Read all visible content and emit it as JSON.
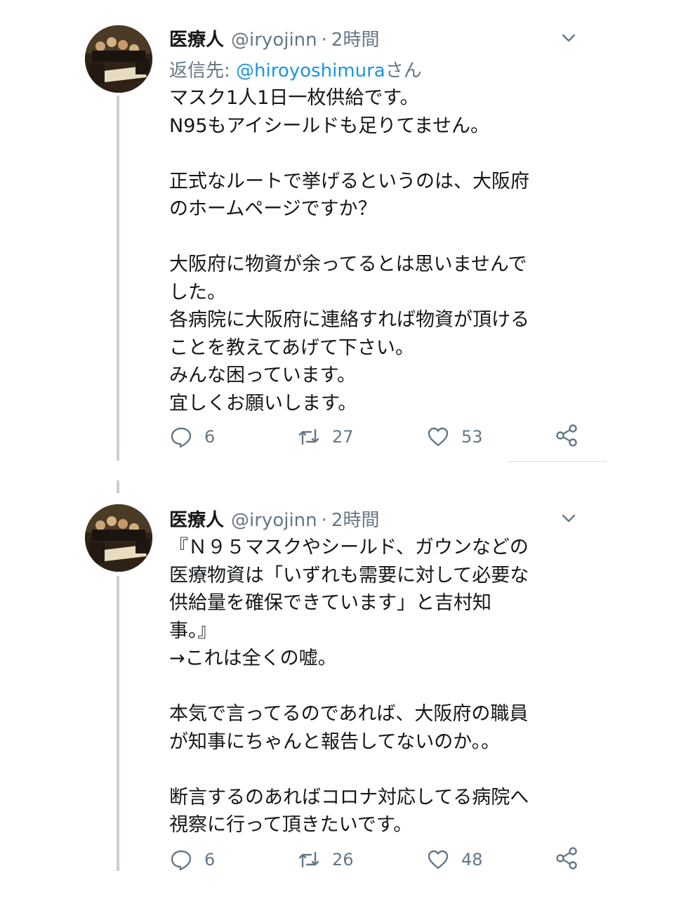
{
  "tweets": [
    {
      "author_name": "医療人",
      "handle": "@iryojinn",
      "separator": "·",
      "time": "2時間",
      "reply_prefix": "返信先: ",
      "reply_mention": "@hiroyoshimura",
      "reply_suffix": "さん",
      "lines": [
        "マスク1人1日一枚供給です。",
        "N95もアイシールドも足りてません。",
        "",
        "正式なルートで挙げるというのは、大阪府",
        "のホームページですか？",
        "",
        "大阪府に物資が余ってるとは思いませんで",
        "した。",
        "各病院に大阪府に連絡すれば物資が頂ける",
        "ことを教えてあげて下さい。",
        "みんな困っています。",
        "宜しくお願いします。"
      ],
      "counts": {
        "reply": "6",
        "retweet": "27",
        "like": "53"
      }
    },
    {
      "author_name": "医療人",
      "handle": "@iryojinn",
      "separator": "·",
      "time": "2時間",
      "lines": [
        "『Ｎ９５マスクやシールド、ガウンなどの",
        "医療物資は「いずれも需要に対して必要な",
        "供給量を確保できています」と吉村知",
        "事。』",
        "→これは全くの嘘。",
        "",
        "本気で言ってるのであれば、大阪府の職員",
        "が知事にちゃんと報告してないのか。。",
        "",
        "断言するのあればコロナ対応してる病院へ",
        "視察に行って頂きたいです。"
      ],
      "counts": {
        "reply": "6",
        "retweet": "26",
        "like": "48"
      }
    }
  ],
  "icons": [
    "avatar-painting",
    "chevron-down-icon",
    "reply-icon",
    "retweet-icon",
    "like-icon",
    "share-icon"
  ],
  "colors": {
    "text": "#14171a",
    "secondary": "#657786",
    "link": "#1b95e0",
    "thread": "#c9cfd4"
  }
}
